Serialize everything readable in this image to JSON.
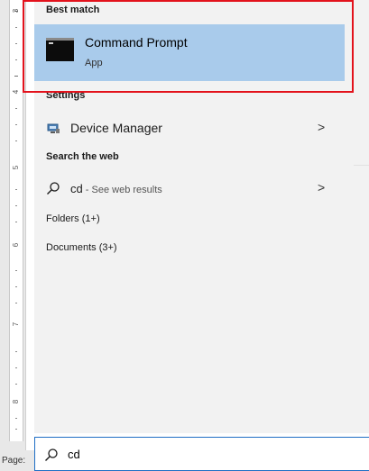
{
  "ruler": {
    "numbers": [
      "3",
      "4",
      "5",
      "6",
      "7",
      "8"
    ],
    "page_label": "Page:"
  },
  "search_results": {
    "best_match": {
      "heading": "Best match",
      "title": "Command Prompt",
      "subtitle": "App",
      "icon": "command-prompt-icon"
    },
    "settings": {
      "heading": "Settings",
      "items": [
        {
          "label": "Device Manager",
          "icon": "device-manager-icon",
          "has_arrow": true
        }
      ]
    },
    "web": {
      "heading": "Search the web",
      "query": "cd",
      "hint": " - See web results",
      "icon": "search-icon"
    },
    "folders": {
      "label": "Folders (1+)"
    },
    "documents": {
      "label": "Documents (3+)"
    },
    "arrow_glyph": ">"
  },
  "search_box": {
    "value": "cd",
    "icon": "search-icon"
  },
  "colors": {
    "highlight": "#e3121c",
    "selected_bg": "#a9cbeb",
    "panel_bg": "#f2f2f2",
    "search_border": "#1f6fc5"
  }
}
